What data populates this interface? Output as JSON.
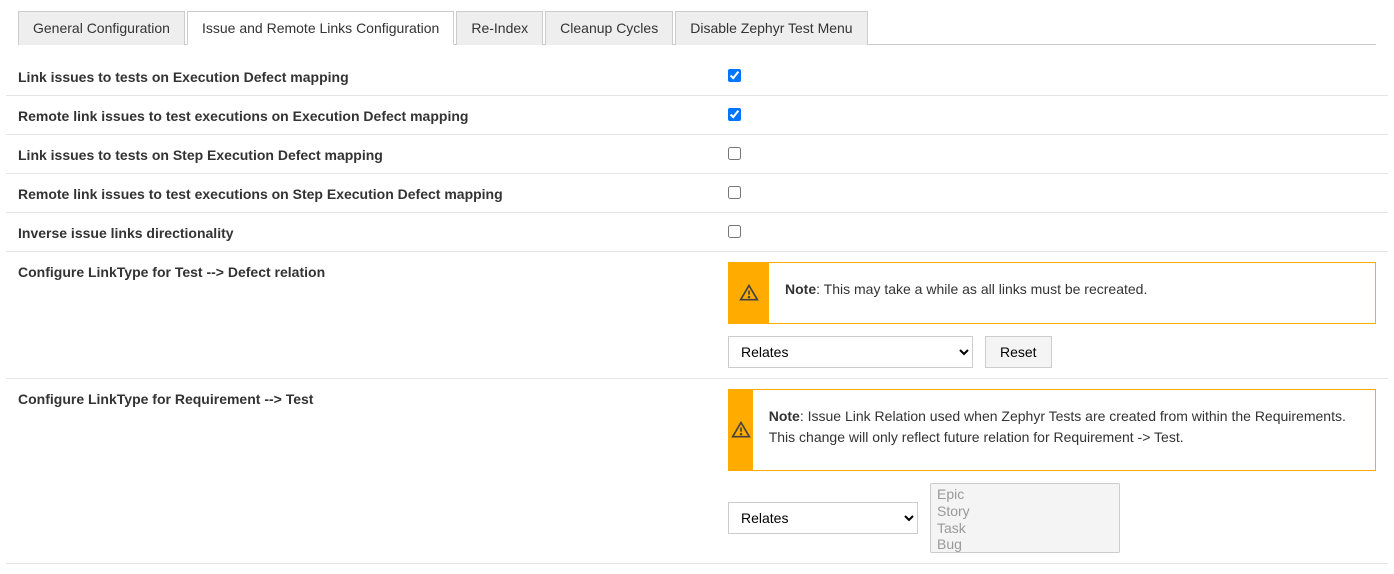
{
  "tabs": [
    {
      "label": "General Configuration",
      "active": false
    },
    {
      "label": "Issue and Remote Links Configuration",
      "active": true
    },
    {
      "label": "Re-Index",
      "active": false
    },
    {
      "label": "Cleanup Cycles",
      "active": false
    },
    {
      "label": "Disable Zephyr Test Menu",
      "active": false
    }
  ],
  "rows": {
    "link_exec_defect": "Link issues to tests on Execution Defect mapping",
    "remote_link_exec_defect": "Remote link issues to test executions on Execution Defect mapping",
    "link_step_exec_defect": "Link issues to tests on Step Execution Defect mapping",
    "remote_link_step_exec_defect": "Remote link issues to test executions on Step Execution Defect mapping",
    "inverse_links": "Inverse issue links directionality",
    "cfg_test_defect": "Configure LinkType for Test --> Defect relation",
    "cfg_req_test": "Configure LinkType for Requirement --> Test"
  },
  "checkboxes": {
    "link_exec_defect": true,
    "remote_link_exec_defect": true,
    "link_step_exec_defect": false,
    "remote_link_step_exec_defect": false,
    "inverse_links": false
  },
  "note_label": "Note",
  "note_test_defect": ": This may take a while as all links must be recreated.",
  "note_req_test": ": Issue Link Relation used when Zephyr Tests are created from within the Requirements. This change will only reflect future relation for Requirement -> Test.",
  "selects": {
    "test_defect_value": "Relates",
    "req_test_value": "Relates",
    "issue_types": [
      "Epic",
      "Story",
      "Task",
      "Bug"
    ]
  },
  "buttons": {
    "reset": "Reset"
  }
}
